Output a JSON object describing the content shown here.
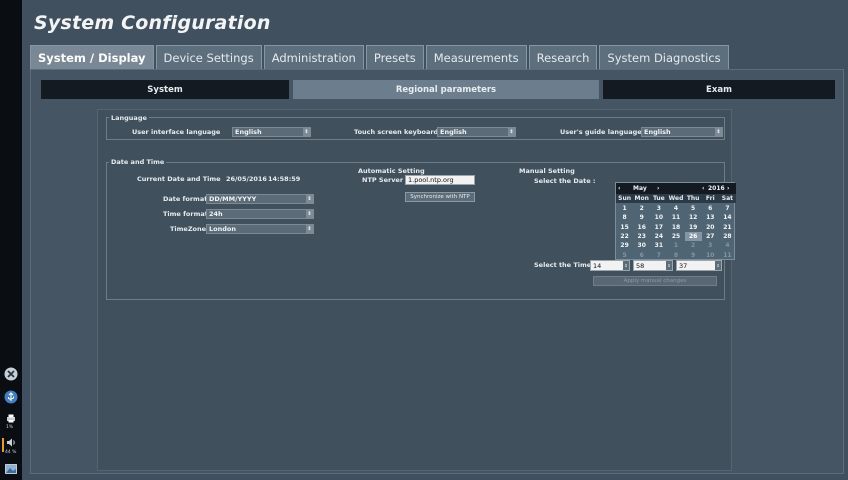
{
  "window": {
    "title": "System Configuration"
  },
  "tabs": [
    {
      "label": "System / Display",
      "active": true
    },
    {
      "label": "Device Settings",
      "active": false
    },
    {
      "label": "Administration",
      "active": false
    },
    {
      "label": "Presets",
      "active": false
    },
    {
      "label": "Measurements",
      "active": false
    },
    {
      "label": "Research",
      "active": false
    },
    {
      "label": "System Diagnostics",
      "active": false
    }
  ],
  "subtabs": [
    {
      "label": "System",
      "active": false
    },
    {
      "label": "Regional parameters",
      "active": true
    },
    {
      "label": "Exam",
      "active": false
    }
  ],
  "language": {
    "legend": "Language",
    "ui_language_label": "User interface language",
    "ui_language_value": "English",
    "keyboard_label": "Touch screen keyboard",
    "keyboard_value": "English",
    "guide_label": "User's guide language",
    "guide_value": "English"
  },
  "datetime": {
    "legend": "Date and Time",
    "current_label": "Current Date and Time",
    "current_date": "26/05/2016",
    "current_time": "14:58:59",
    "date_format_label": "Date format",
    "date_format_value": "DD/MM/YYYY",
    "time_format_label": "Time format",
    "time_format_value": "24h",
    "timezone_label": "TimeZone",
    "timezone_value": "London"
  },
  "automatic": {
    "heading": "Automatic Setting",
    "ntp_label": "NTP Server",
    "ntp_value": "1.pool.ntp.org",
    "sync_button": "Synchronize with NTP"
  },
  "manual": {
    "heading": "Manual Setting",
    "select_date_label": "Select the Date :",
    "select_time_label": "Select the Time :",
    "apply_button": "Apply manual changes",
    "hour": "14",
    "minute": "58",
    "second": "37"
  },
  "calendar": {
    "prev_month": "‹",
    "month": "May",
    "next_month": "›",
    "prev_year": "‹",
    "year": "2016",
    "next_year": "›",
    "weekdays": [
      "Sun",
      "Mon",
      "Tue",
      "Wed",
      "Thu",
      "Fri",
      "Sat"
    ],
    "days": [
      {
        "d": "1",
        "t": "cur"
      },
      {
        "d": "2",
        "t": "cur"
      },
      {
        "d": "3",
        "t": "cur"
      },
      {
        "d": "4",
        "t": "cur"
      },
      {
        "d": "5",
        "t": "cur"
      },
      {
        "d": "6",
        "t": "cur"
      },
      {
        "d": "7",
        "t": "cur"
      },
      {
        "d": "8",
        "t": "cur"
      },
      {
        "d": "9",
        "t": "cur"
      },
      {
        "d": "10",
        "t": "cur"
      },
      {
        "d": "11",
        "t": "cur"
      },
      {
        "d": "12",
        "t": "cur"
      },
      {
        "d": "13",
        "t": "cur"
      },
      {
        "d": "14",
        "t": "cur"
      },
      {
        "d": "15",
        "t": "cur"
      },
      {
        "d": "16",
        "t": "cur"
      },
      {
        "d": "17",
        "t": "cur"
      },
      {
        "d": "18",
        "t": "cur"
      },
      {
        "d": "19",
        "t": "cur"
      },
      {
        "d": "20",
        "t": "cur"
      },
      {
        "d": "21",
        "t": "cur"
      },
      {
        "d": "22",
        "t": "cur"
      },
      {
        "d": "23",
        "t": "cur"
      },
      {
        "d": "24",
        "t": "cur"
      },
      {
        "d": "25",
        "t": "cur"
      },
      {
        "d": "26",
        "t": "sel"
      },
      {
        "d": "27",
        "t": "cur"
      },
      {
        "d": "28",
        "t": "cur"
      },
      {
        "d": "29",
        "t": "cur"
      },
      {
        "d": "30",
        "t": "cur"
      },
      {
        "d": "31",
        "t": "cur"
      },
      {
        "d": "1",
        "t": "other"
      },
      {
        "d": "2",
        "t": "other"
      },
      {
        "d": "3",
        "t": "other"
      },
      {
        "d": "4",
        "t": "other"
      },
      {
        "d": "5",
        "t": "other"
      },
      {
        "d": "6",
        "t": "other"
      },
      {
        "d": "7",
        "t": "other"
      },
      {
        "d": "8",
        "t": "other"
      },
      {
        "d": "9",
        "t": "other"
      },
      {
        "d": "10",
        "t": "other"
      },
      {
        "d": "11",
        "t": "other"
      }
    ]
  },
  "status": {
    "print_pct": "1%",
    "volume_pct": "44 %"
  },
  "colors": {
    "background": "#41505e",
    "active_tab": "#7a8896",
    "dark_tab": "#131a21",
    "selected_day": "#8595a3"
  }
}
